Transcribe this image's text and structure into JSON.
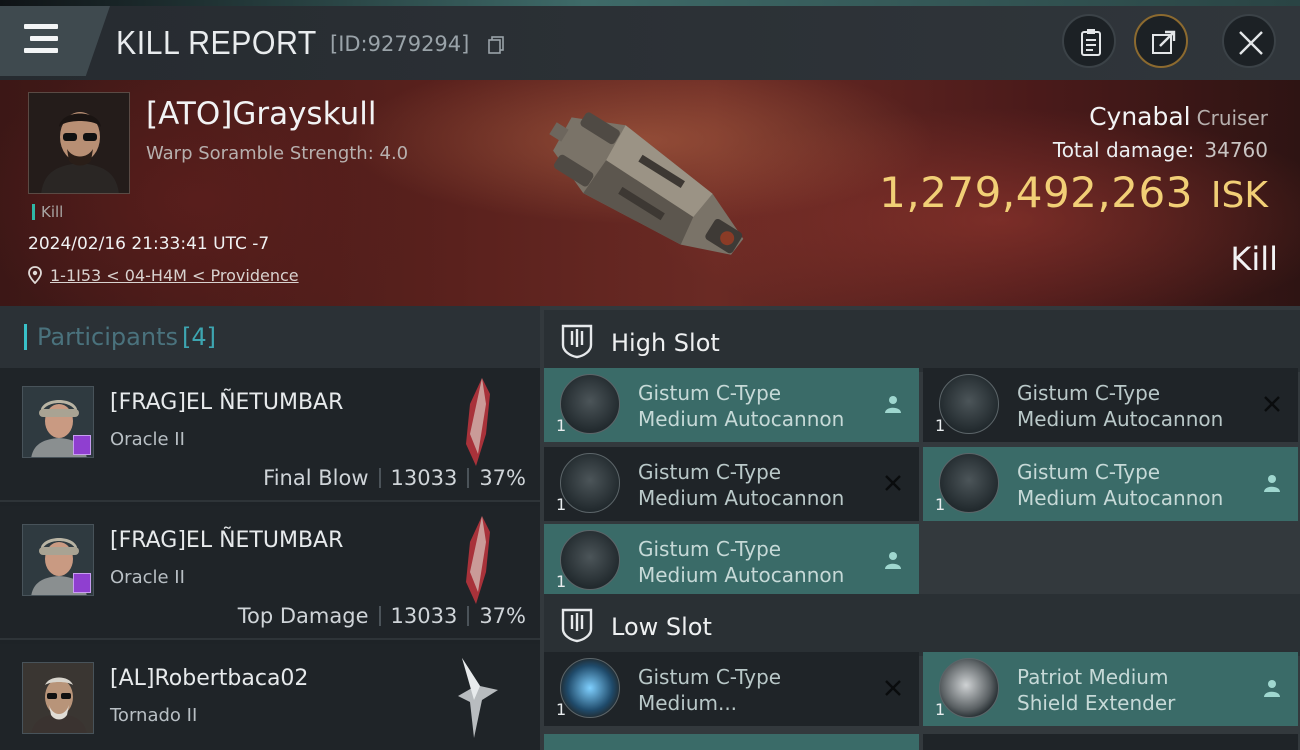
{
  "header": {
    "title": "KILL REPORT",
    "report_id": "[ID:9279294]",
    "icons": [
      "menu-icon",
      "copy-icon",
      "clipboard-icon",
      "share-icon",
      "close-icon"
    ]
  },
  "victim": {
    "pilot": "[ATO]Grayskull",
    "warp_scramble": "Warp Soramble Strength: 4.0",
    "event_type": "Kill",
    "datetime": "2024/02/16 21:33:41 UTC -7",
    "location": "1-1I53 < 04-H4M < Providence",
    "ship_name": "Cynabal",
    "ship_class": "Cruiser",
    "total_damage_label": "Total damage:",
    "total_damage": "34760",
    "isk_value": "1,279,492,263",
    "isk_unit": "ISK",
    "result": "Kill"
  },
  "participants": {
    "label": "Participants",
    "count": "[4]",
    "rows": [
      {
        "name": "[FRAG]EL ÑETUMBAR",
        "ship": "Oracle II",
        "role": "Final Blow",
        "damage": "13033",
        "percent": "37%"
      },
      {
        "name": "[FRAG]EL ÑETUMBAR",
        "ship": "Oracle II",
        "role": "Top Damage",
        "damage": "13033",
        "percent": "37%"
      },
      {
        "name": "[AL]Robertbaca02",
        "ship": "Tornado II"
      }
    ]
  },
  "slots": {
    "high_label": "High Slot",
    "low_label": "Low Slot",
    "high": [
      {
        "line1": "Gistum C-Type",
        "line2": "Medium Autocannon",
        "qty": "1",
        "status": "fitted"
      },
      {
        "line1": "Gistum C-Type",
        "line2": "Medium Autocannon",
        "qty": "1",
        "status": "destroyed"
      },
      {
        "line1": "Gistum C-Type",
        "line2": "Medium Autocannon",
        "qty": "1",
        "status": "destroyed"
      },
      {
        "line1": "Gistum C-Type",
        "line2": "Medium Autocannon",
        "qty": "1",
        "status": "fitted"
      },
      {
        "line1": "Gistum C-Type",
        "line2": "Medium Autocannon",
        "qty": "1",
        "status": "fitted"
      }
    ],
    "low": [
      {
        "line1": "Gistum C-Type",
        "line2": "Medium...",
        "qty": "1",
        "status": "destroyed"
      },
      {
        "line1": "Patriot Medium",
        "line2": "Shield Extender",
        "qty": "1",
        "status": "fitted"
      }
    ]
  },
  "colors": {
    "accent": "#3a6b68",
    "isk": "#f1cf76",
    "teal": "#39c1c9"
  }
}
